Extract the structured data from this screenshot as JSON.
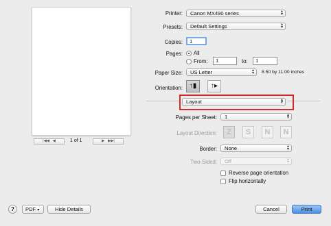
{
  "printer": {
    "label": "Printer:",
    "value": "Canon MX490 series"
  },
  "presets": {
    "label": "Presets:",
    "value": "Default Settings"
  },
  "copies": {
    "label": "Copies:",
    "value": "1"
  },
  "pages": {
    "label": "Pages:",
    "all_label": "All",
    "from_label": "From:",
    "from_value": "1",
    "to_label": "to:",
    "to_value": "1"
  },
  "paper_size": {
    "label": "Paper Size:",
    "value": "US Letter",
    "dimensions": "8.50 by 11.00 inches"
  },
  "orientation": {
    "label": "Orientation:",
    "options": [
      "portrait",
      "landscape"
    ],
    "selected": "portrait"
  },
  "section": {
    "value": "Layout"
  },
  "pages_per_sheet": {
    "label": "Pages per Sheet:",
    "value": "1"
  },
  "layout_direction": {
    "label": "Layout Direction:",
    "options": [
      "Z",
      "S",
      "N",
      "N"
    ]
  },
  "border": {
    "label": "Border:",
    "value": "None"
  },
  "two_sided": {
    "label": "Two-Sided:",
    "value": "Off"
  },
  "reverse_orientation": {
    "label": "Reverse page orientation",
    "checked": false
  },
  "flip_horizontal": {
    "label": "Flip horizontally",
    "checked": false
  },
  "preview_nav": {
    "first": "|◀◀",
    "prev": "◀",
    "page_text": "1 of 1",
    "next": "▶",
    "last": "▶▶|"
  },
  "footer": {
    "help": "?",
    "pdf": "PDF",
    "hide_details": "Hide Details",
    "cancel": "Cancel",
    "print": "Print"
  },
  "colors": {
    "highlight": "#d42a2a",
    "primary_button": "#4d8fe3"
  }
}
